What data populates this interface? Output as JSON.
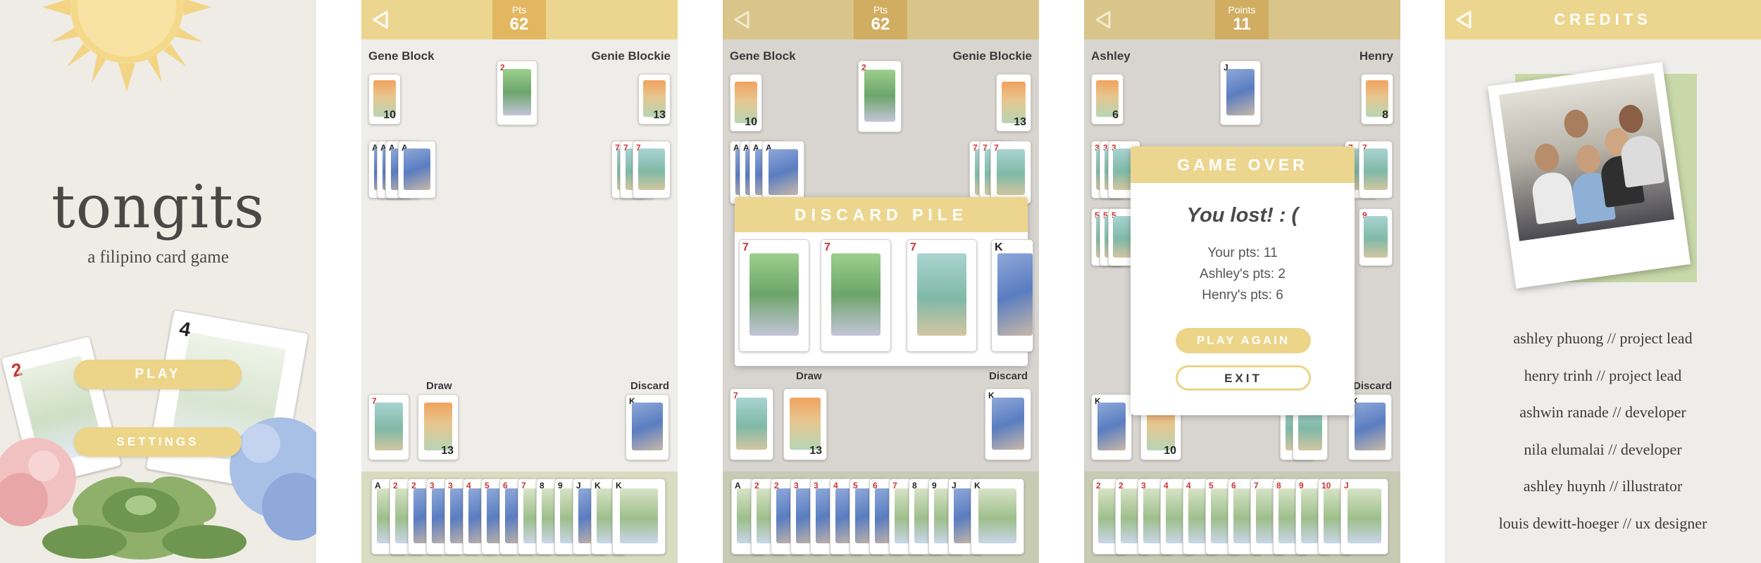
{
  "title_screen": {
    "logo": "tongits",
    "tagline": "a filipino card game",
    "play_label": "PLAY",
    "settings_label": "SETTINGS",
    "deco_card_ranks": [
      "2",
      "4"
    ]
  },
  "game_screen_1": {
    "score_label": "Pts",
    "score_value": "62",
    "left_player": "Gene Block",
    "right_player": "Genie Blockie",
    "left_count": "10",
    "right_count": "13",
    "draw_label": "Draw",
    "draw_count": "13",
    "discard_label": "Discard"
  },
  "game_screen_2": {
    "score_label": "Pts",
    "score_value": "62",
    "left_player": "Gene Block",
    "right_player": "Genie Blockie",
    "left_count": "10",
    "right_count": "13",
    "draw_label": "Draw",
    "draw_count": "13",
    "discard_label": "Discard",
    "modal_title": "DISCARD PILE",
    "pile_ranks": [
      "7",
      "7",
      "7",
      "K"
    ]
  },
  "game_screen_3": {
    "score_label": "Points",
    "score_value": "11",
    "left_player": "Ashley",
    "right_player": "Henry",
    "left_count": "6",
    "right_count": "8",
    "hand_count": "10",
    "discard_label": "Discard",
    "modal_title": "GAME OVER",
    "result": "You lost! : (",
    "stats": [
      "Your pts: 11",
      "Ashley's pts: 2",
      "Henry's pts: 6"
    ],
    "play_again_label": "PLAY AGAIN",
    "exit_label": "EXIT"
  },
  "credits": {
    "title": "CREDITS",
    "lines": [
      "ashley phuong // project lead",
      "henry trinh // project lead",
      "ashwin ranade // developer",
      "nila elumalai // developer",
      "ashley huynh // illustrator",
      "louis dewitt-hoeger // ux designer"
    ]
  },
  "colors": {
    "accent": "#ecd68f",
    "score_box": "#e2b75f",
    "button": "#ecd488",
    "tray": "#d8dcc0"
  }
}
